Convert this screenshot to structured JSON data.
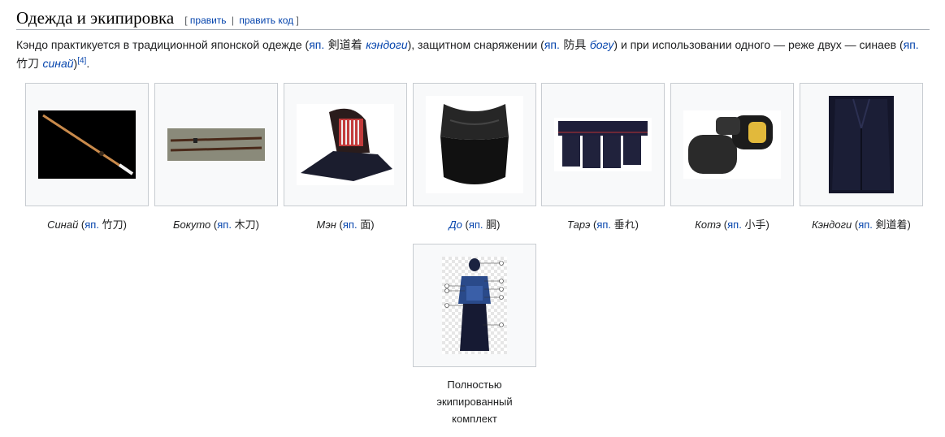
{
  "section": {
    "title": "Одежда и экипировка",
    "edit_open": "[",
    "edit_label": "править",
    "edit_sep": "|",
    "edit_code_label": "править код",
    "edit_close": "]"
  },
  "paragraph": {
    "t1": "Кэндо практикуется в традиционной японской одежде (",
    "lang1": "яп.",
    "jp1": " 剣道着 ",
    "word1": "кэндоги",
    "t2": "), защитном снаряжении (",
    "lang2": "яп.",
    "jp2": " 防具 ",
    "word2": "богу",
    "t3": ") и при использовании одного — реже двух — синаев (",
    "lang3": "яп.",
    "jp3": "竹刀 ",
    "word3": "синай",
    "t4": ")",
    "ref": "[4]",
    "t5": "."
  },
  "gallery": [
    {
      "name": "Синай",
      "lang": "яп.",
      "jp": "竹刀",
      "name_is_link": false,
      "image": "shinai-image"
    },
    {
      "name": "Бокуто",
      "lang": "яп.",
      "jp": "木刀",
      "name_is_link": false,
      "image": "bokuto-image"
    },
    {
      "name": "Мэн",
      "lang": "яп.",
      "jp": "面",
      "name_is_link": false,
      "image": "men-image"
    },
    {
      "name": "До",
      "lang": "яп.",
      "jp": "胴",
      "name_is_link": true,
      "image": "do-image"
    },
    {
      "name": "Тарэ",
      "lang": "яп.",
      "jp": "垂れ",
      "name_is_link": false,
      "image": "tare-image"
    },
    {
      "name": "Котэ",
      "lang": "яп.",
      "jp": "小手",
      "name_is_link": false,
      "image": "kote-image"
    },
    {
      "name": "Кэндоги",
      "lang": "яп.",
      "jp": "剣道着",
      "name_is_link": false,
      "image": "kendogi-image"
    }
  ],
  "full_set": {
    "caption_line1": "Полностью",
    "caption_line2": "экипированный",
    "caption_line3": "комплект",
    "image": "full-kit-image"
  },
  "colors": {
    "link": "#0645ad",
    "text": "#202122",
    "box_bg": "#f8f9fa",
    "box_border": "#c8ccd1"
  }
}
